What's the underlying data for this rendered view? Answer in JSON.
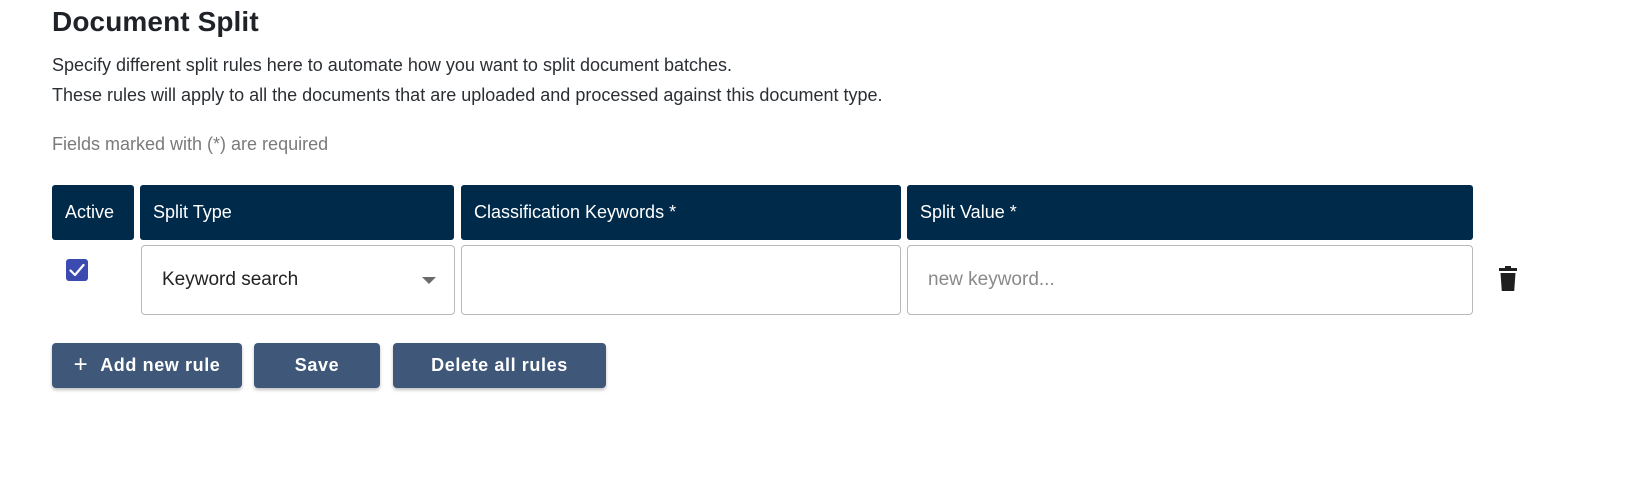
{
  "header": {
    "title": "Document Split",
    "description_line1": "Specify different split rules here to automate how you want to split document batches.",
    "description_line2": "These rules will apply to all the documents that are uploaded and processed against this document type.",
    "required_note": "Fields marked with (*) are required"
  },
  "table": {
    "columns": [
      "Active",
      "Split Type",
      "Classification Keywords *",
      "Split Value *"
    ],
    "rows": [
      {
        "active": true,
        "split_type": "Keyword search",
        "classification_keywords": "",
        "split_value_placeholder": "new keyword..."
      }
    ]
  },
  "actions": {
    "add_rule_icon": "+",
    "add_rule_label": "Add new rule",
    "save_label": "Save",
    "delete_all_label": "Delete all rules"
  },
  "icons": {
    "checkbox": "checkmark-icon",
    "select": "caret-down-icon",
    "delete_row": "trash-icon"
  },
  "colors": {
    "header_bg": "#002a4a",
    "button_bg": "#3f5779",
    "checkbox_bg": "#3b4bb0"
  }
}
